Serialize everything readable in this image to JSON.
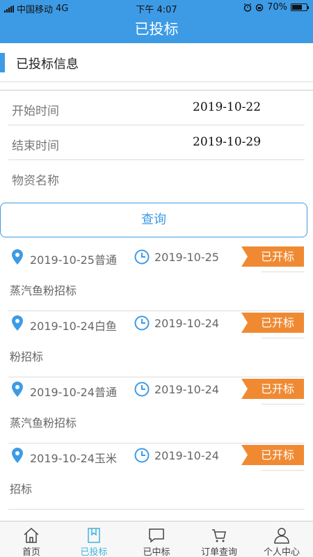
{
  "status_bar": {
    "carrier": "中国移动",
    "network": "4G",
    "time": "下午 4:07",
    "battery": "70%",
    "battery_level": 0.7
  },
  "nav": {
    "title": "已投标"
  },
  "section": {
    "title": "已投标信息"
  },
  "form": {
    "start_label": "开始时间",
    "start_value": "2019-10-22",
    "end_label": "结束时间",
    "end_value": "2019-10-29",
    "goods_label": "物资名称",
    "goods_value": ""
  },
  "query_button": "查询",
  "bids": [
    {
      "location_line": "2019-10-25普通",
      "date": "2019-10-25",
      "status": "已开标",
      "name_cont": "蒸汽鱼粉招标"
    },
    {
      "location_line": "2019-10-24白鱼",
      "date": "2019-10-24",
      "status": "已开标",
      "name_cont": "粉招标"
    },
    {
      "location_line": "2019-10-24普通",
      "date": "2019-10-24",
      "status": "已开标",
      "name_cont": "蒸汽鱼粉招标"
    },
    {
      "location_line": "2019-10-24玉米",
      "date": "2019-10-24",
      "status": "已开标",
      "name_cont": "招标"
    }
  ],
  "tabs": [
    {
      "label": "首页",
      "icon": "home-icon"
    },
    {
      "label": "已投标",
      "icon": "bookmark-icon",
      "active": true
    },
    {
      "label": "已中标",
      "icon": "chat-icon"
    },
    {
      "label": "订单查询",
      "icon": "cart-icon"
    },
    {
      "label": "个人中心",
      "icon": "user-icon"
    }
  ],
  "colors": {
    "primary": "#3d9be6",
    "badge": "#ef8a33",
    "tab_active": "#3db4e0"
  }
}
